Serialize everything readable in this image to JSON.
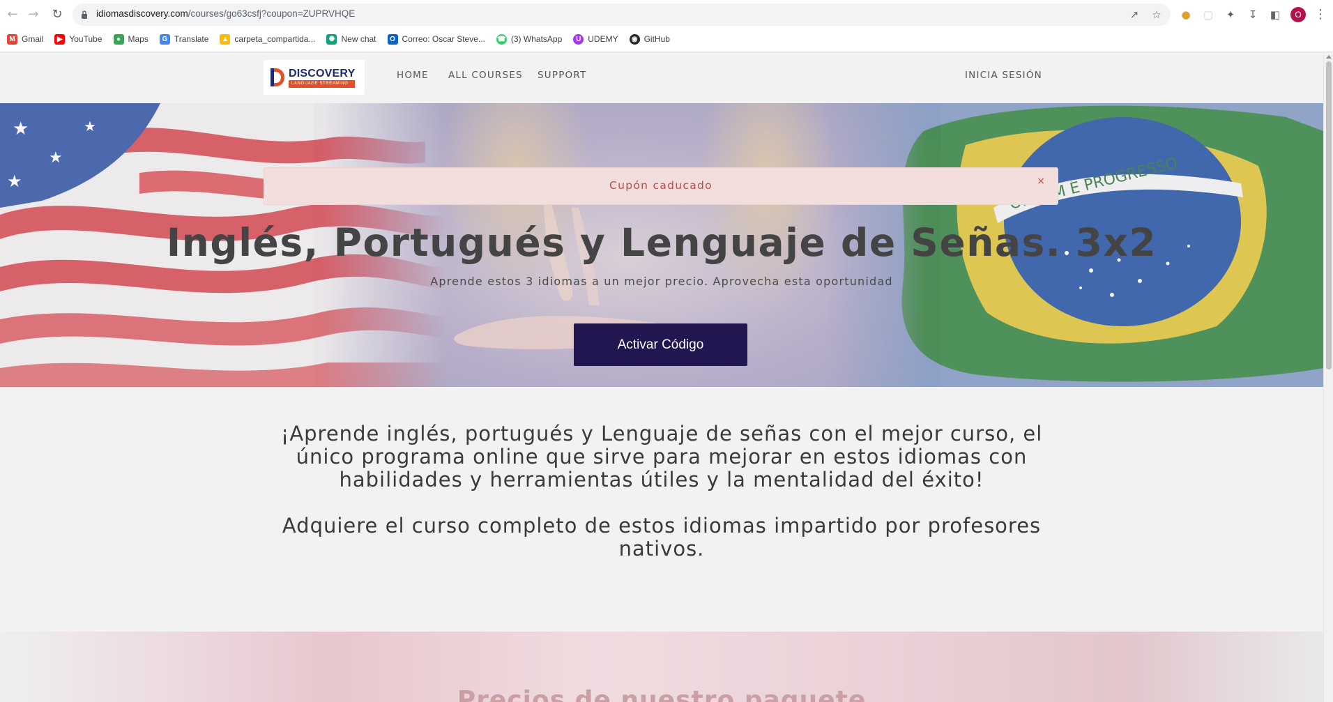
{
  "browser": {
    "url_host": "idiomasdiscovery.com",
    "url_path": "/courses/go63csfj?coupon=ZUPRVHQE",
    "profile_initial": "O",
    "bookmarks": [
      {
        "label": "Gmail",
        "icon": "gmail-icon",
        "color": "#ea4335"
      },
      {
        "label": "YouTube",
        "icon": "youtube-icon",
        "color": "#ff0000"
      },
      {
        "label": "Maps",
        "icon": "maps-icon",
        "color": "#34a853"
      },
      {
        "label": "Translate",
        "icon": "translate-icon",
        "color": "#4285f4"
      },
      {
        "label": "carpeta_compartida...",
        "icon": "drive-icon",
        "color": "#fbbc04"
      },
      {
        "label": "New chat",
        "icon": "chatgpt-icon",
        "color": "#10a37f"
      },
      {
        "label": "Correo: Oscar Steve...",
        "icon": "outlook-icon",
        "color": "#0a64c8"
      },
      {
        "label": "(3) WhatsApp",
        "icon": "whatsapp-icon",
        "color": "#25d366"
      },
      {
        "label": "UDEMY",
        "icon": "udemy-icon",
        "color": "#a435f0"
      },
      {
        "label": "GitHub",
        "icon": "github-icon",
        "color": "#24292f"
      }
    ]
  },
  "site": {
    "logo_word": "DISCOVERY",
    "logo_sub": "LANGUAGE STREAMING",
    "nav": {
      "home": "HOME",
      "all_courses": "ALL COURSES",
      "support": "SUPPORT",
      "login": "INICIA SESIÓN"
    }
  },
  "alert": {
    "text": "Cupón caducado",
    "close": "×"
  },
  "hero": {
    "title": "Inglés, Portugués y Lenguaje de Señas. 3x2",
    "subtitle": "Aprende estos 3 idiomas a un mejor precio. Aprovecha esta oportunidad",
    "cta_label": "Activar Código",
    "flag_motto": "ORDEM E PROGRESSO"
  },
  "content": {
    "paragraph_1": "¡Aprende inglés, portugués y Lenguaje de señas con el mejor curso, el único programa online que sirve para mejorar en estos idiomas con habilidades y herramientas útiles y la mentalidad del éxito!",
    "paragraph_2": "Adquiere el curso completo de estos idiomas impartido por profesores nativos."
  },
  "pricing": {
    "title": "Precios de nuestro paquete"
  },
  "colors": {
    "cta_bg": "#221650",
    "alert_bg": "#f3dede",
    "alert_text": "#b94a48"
  }
}
